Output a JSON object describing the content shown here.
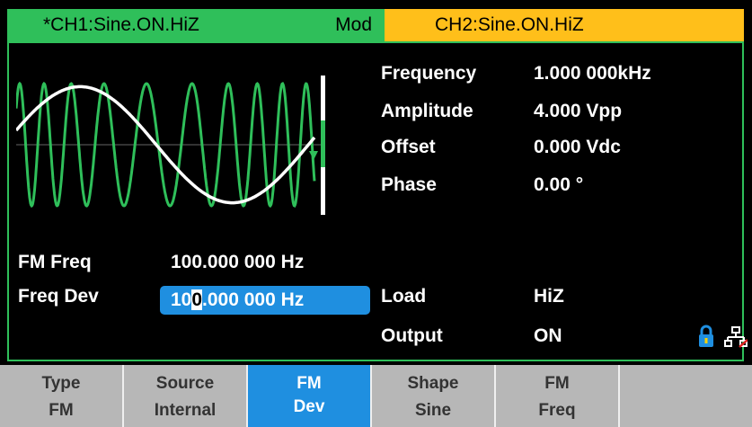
{
  "channels": {
    "ch1_title": "*CH1:Sine.ON.HiZ",
    "ch1_mode": "Mod",
    "ch2_title": "CH2:Sine.ON.HiZ",
    "colors": {
      "ch1": "#2fbf5a",
      "ch2": "#ffbf1a",
      "highlight": "#1f8fe0"
    }
  },
  "params": [
    {
      "label": "Frequency",
      "value": "1.000 000kHz"
    },
    {
      "label": "Amplitude",
      "value": "4.000 Vpp"
    },
    {
      "label": "Offset",
      "value": "0.000 Vdc"
    },
    {
      "label": "Phase",
      "value": "0.00 °"
    }
  ],
  "mod_params": {
    "fm_freq_label": "FM Freq",
    "fm_freq_value": "100.000 000 Hz",
    "freq_dev_label": "Freq Dev",
    "freq_dev_value_pre": "10",
    "freq_dev_value_cursor": "0",
    "freq_dev_value_post": ".000 000 Hz"
  },
  "output": {
    "load_label": "Load",
    "load_value": "HiZ",
    "output_label": "Output",
    "output_value": "ON"
  },
  "icons": [
    "lock-icon",
    "network-icon",
    "waveform-preview"
  ],
  "softkeys": [
    {
      "l1": "Type",
      "l2": "FM"
    },
    {
      "l1": "Source",
      "l2": "Internal"
    },
    {
      "l1": "FM",
      "l2": "Dev"
    },
    {
      "l1": "Shape",
      "l2": "Sine"
    },
    {
      "l1": "FM",
      "l2": "Freq"
    },
    {
      "l1": "",
      "l2": ""
    }
  ]
}
